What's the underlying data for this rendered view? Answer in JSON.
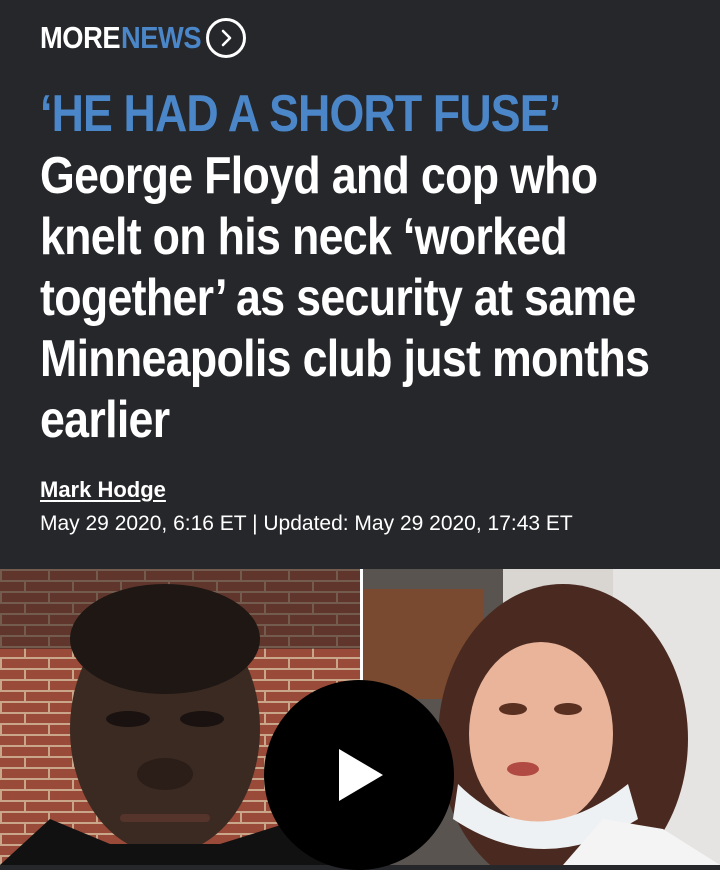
{
  "header": {
    "more": "MORE",
    "news": "NEWS",
    "chevron_icon": "chevron-right-circle-icon"
  },
  "article": {
    "kicker": "‘HE HAD A SHORT FUSE’",
    "headline": "George Floyd and cop who knelt on his neck ‘worked together’ as security at same Minneapolis club just months earlier",
    "author": "Mark Hodge",
    "date": "May 29 2020, 6:16 ET | Updated: May 29 2020, 17:43 ET"
  },
  "media": {
    "play_icon": "play-icon"
  },
  "colors": {
    "background": "#26272b",
    "accent": "#4a86c8",
    "text": "#ffffff"
  }
}
